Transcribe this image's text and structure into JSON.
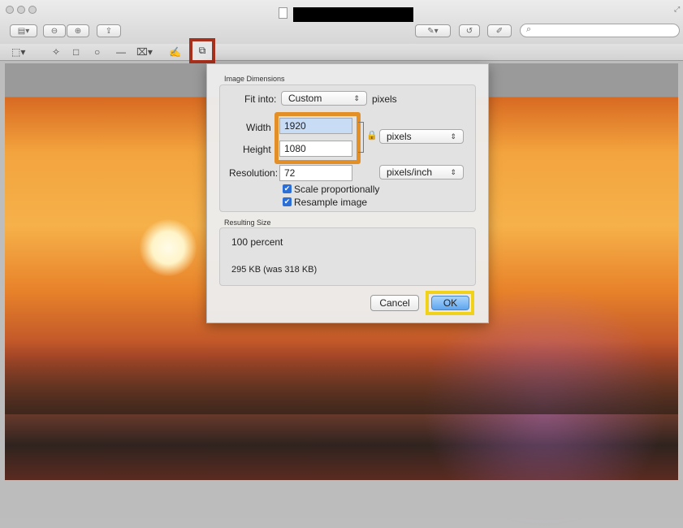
{
  "app": {
    "window_title": "",
    "search_placeholder": ""
  },
  "toolbar_icons": [
    "sidebar-icon",
    "zoom-out-icon",
    "zoom-in-icon",
    "share-icon",
    "annotate-icon",
    "rotate-icon",
    "markup-toolbox-icon",
    "search-icon"
  ],
  "tools": [
    "selection-icon",
    "instant-alpha-icon",
    "rectangle-icon",
    "oval-icon",
    "line-icon",
    "text-icon",
    "sign-icon",
    "adjust-size-icon"
  ],
  "dialog": {
    "image_dimensions_label": "Image Dimensions",
    "fit_into_label": "Fit into:",
    "fit_into_value": "Custom",
    "fit_into_unit": "pixels",
    "width_label": "Width",
    "width_value": "1920",
    "height_label": "Height",
    "height_value": "1080",
    "dimension_unit": "pixels",
    "resolution_label": "Resolution:",
    "resolution_value": "72",
    "resolution_unit": "pixels/inch",
    "scale_label": "Scale proportionally",
    "scale_checked": true,
    "resample_label": "Resample image",
    "resample_checked": true,
    "resulting_size_label": "Resulting Size",
    "percent_text": "100 percent",
    "size_text": "295 KB (was 318 KB)",
    "cancel_label": "Cancel",
    "ok_label": "OK"
  },
  "colors": {
    "highlight_tool": "#a6301c",
    "highlight_fields": "#e38f28",
    "highlight_ok": "#f0d21a",
    "default_button": "#6fb3f2"
  }
}
